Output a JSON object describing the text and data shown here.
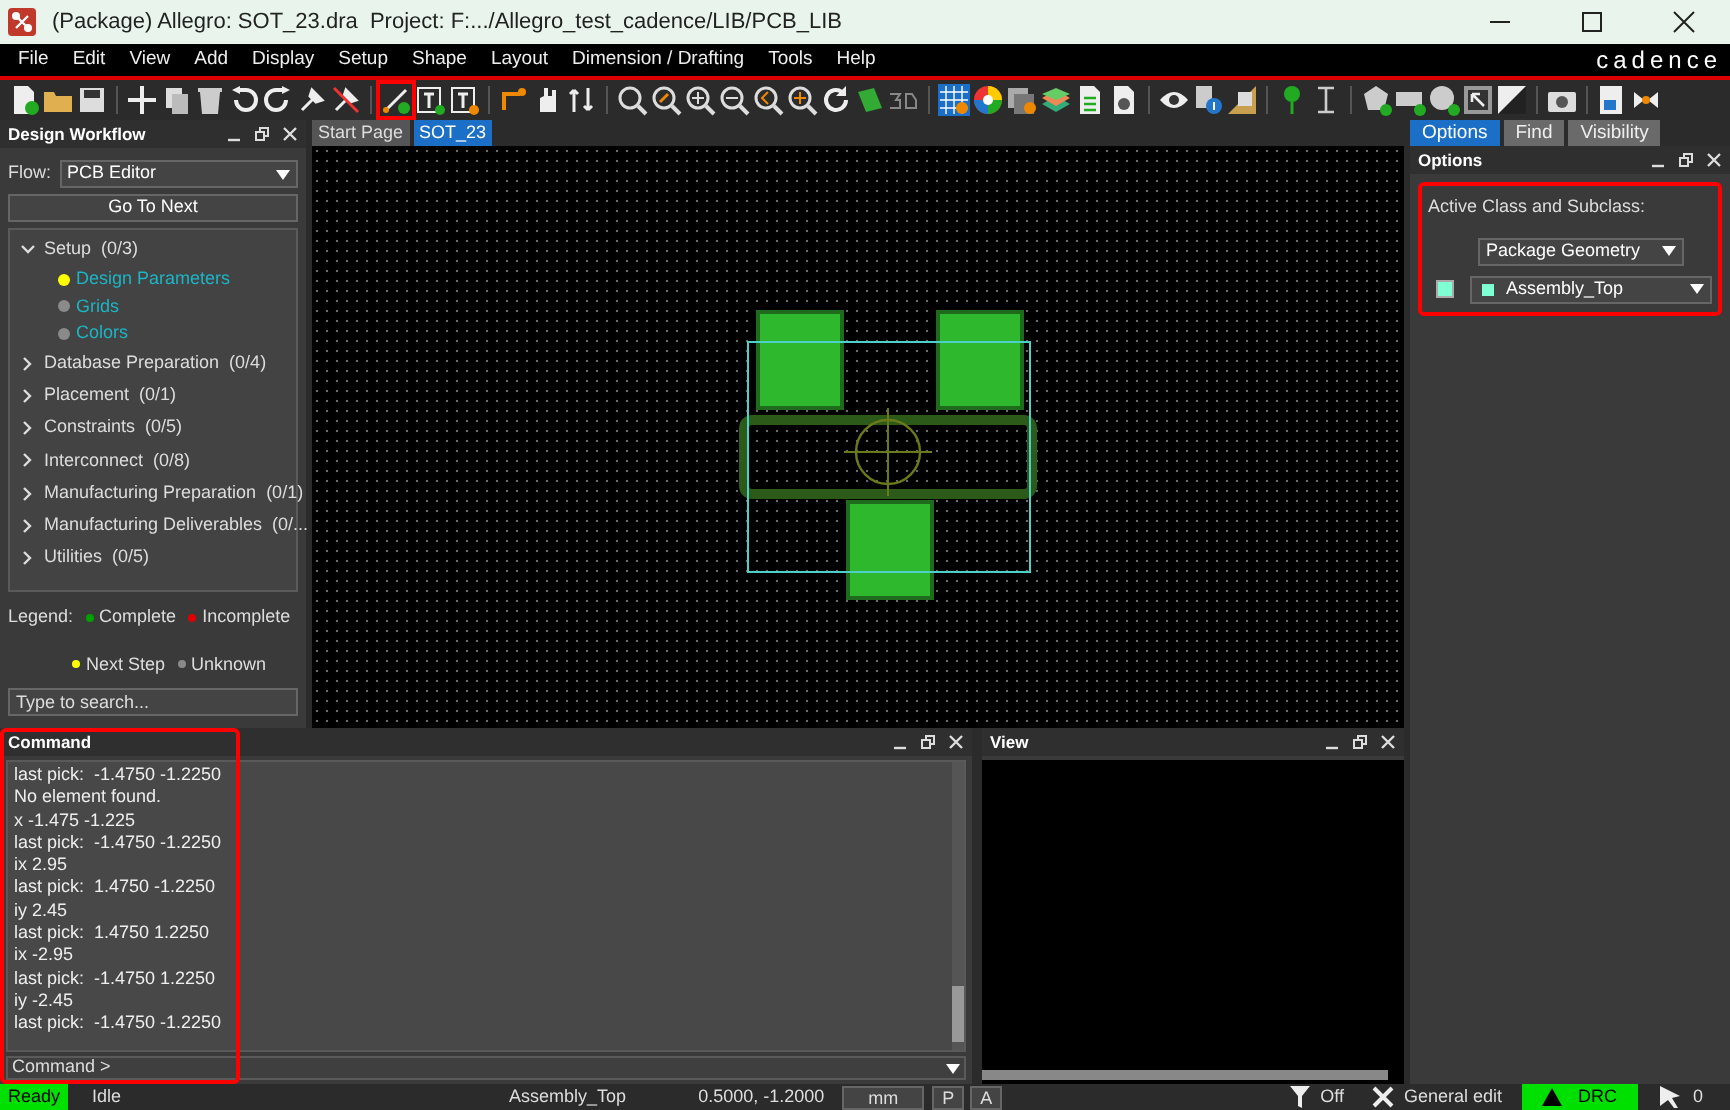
{
  "window": {
    "title": "(Package) Allegro: SOT_23.dra  Project: F:.../Allegro_test_cadence/LIB/PCB_LIB"
  },
  "menu": [
    "File",
    "Edit",
    "View",
    "Add",
    "Display",
    "Setup",
    "Shape",
    "Layout",
    "Dimension / Drafting",
    "Tools",
    "Help"
  ],
  "brand": "cadence",
  "toolbar": {
    "add_line_highlighted": true
  },
  "workflow_panel": {
    "title": "Design Workflow",
    "flow_label": "Flow:",
    "flow_value": "PCB Editor",
    "go_button": "Go To Next",
    "tree": [
      {
        "label": "Setup  (0/3)",
        "expanded": true,
        "children": [
          {
            "label": "Design Parameters",
            "color": "#ffff00"
          },
          {
            "label": "Grids",
            "color": "#8a8a8a"
          },
          {
            "label": "Colors",
            "color": "#8a8a8a"
          }
        ]
      },
      {
        "label": "Database Preparation  (0/4)",
        "expanded": false
      },
      {
        "label": "Placement  (0/1)",
        "expanded": false
      },
      {
        "label": "Constraints  (0/5)",
        "expanded": false
      },
      {
        "label": "Interconnect  (0/8)",
        "expanded": false
      },
      {
        "label": "Manufacturing Preparation  (0/1)",
        "expanded": false
      },
      {
        "label": "Manufacturing Deliverables  (0/...",
        "expanded": false
      },
      {
        "label": "Utilities  (0/5)",
        "expanded": false
      }
    ],
    "legend_label": "Legend:",
    "legend": [
      {
        "label": "Complete",
        "color": "#00a000"
      },
      {
        "label": "Incomplete",
        "color": "#e00000"
      },
      {
        "label": "Next Step",
        "color": "#ffff00"
      },
      {
        "label": "Unknown",
        "color": "#8a8a8a"
      }
    ],
    "search": {
      "placeholder": "Type to search..."
    }
  },
  "canvas_tabs": [
    {
      "label": "Start Page",
      "selected": false
    },
    {
      "label": "SOT_23",
      "selected": true
    }
  ],
  "right_tabs": [
    {
      "label": "Options",
      "selected": true
    },
    {
      "label": "Find",
      "selected": false
    },
    {
      "label": "Visibility",
      "selected": false
    }
  ],
  "options_panel": {
    "title": "Options",
    "highlighted": true,
    "label": "Active Class and Subclass:",
    "class_value": "Package Geometry",
    "subclass_value": "Assembly_Top"
  },
  "command_panel": {
    "title": "Command",
    "highlighted": true,
    "lines": [
      "last pick:  -1.4750 -1.2250",
      "No element found.",
      "x -1.475 -1.225",
      "last pick:  -1.4750 -1.2250",
      "ix 2.95",
      "last pick:  1.4750 -1.2250",
      "iy 2.45",
      "last pick:  1.4750 1.2250",
      "ix -2.95",
      "last pick:  -1.4750 1.2250",
      "iy -2.45",
      "last pick:  -1.4750 -1.2250"
    ],
    "prompt": "Command >"
  },
  "view_panel": {
    "title": "View"
  },
  "status_bar": {
    "state": "Ready",
    "mode": "Idle",
    "subclass": "Assembly_Top",
    "coords": "0.5000, -1.2000",
    "units": "mm",
    "p_button": "P",
    "a_button": "A",
    "filter": "Off",
    "edit_mode": "General edit",
    "drc": "DRC",
    "pick_count": "0"
  }
}
